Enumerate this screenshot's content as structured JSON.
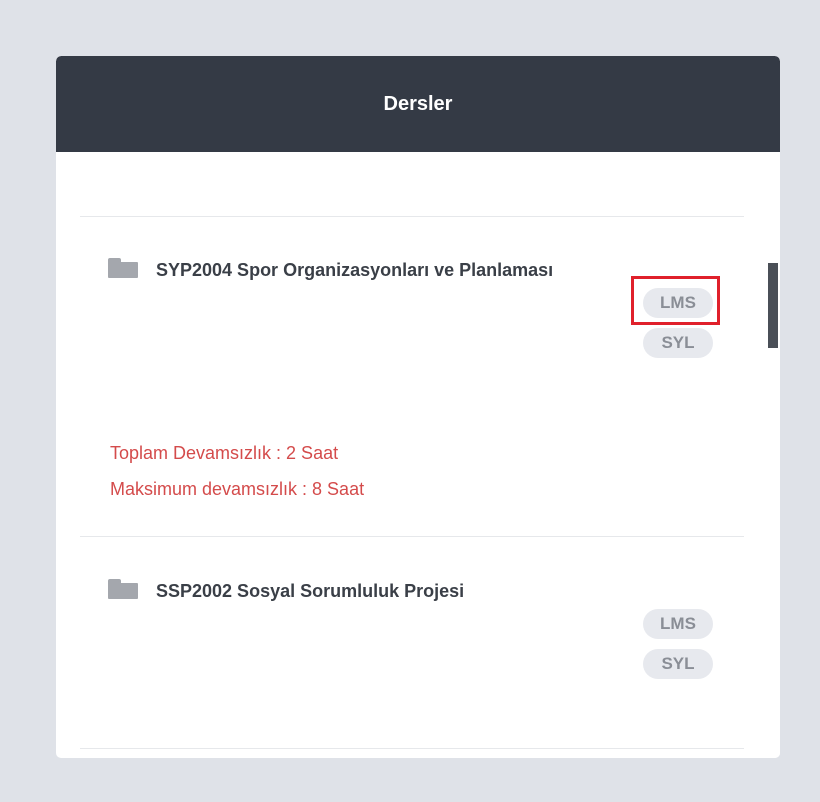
{
  "panel": {
    "title": "Dersler"
  },
  "courses": [
    {
      "title": "SYP2004 Spor Organizasyonları ve Planlaması",
      "badges": [
        "LMS",
        "SYL"
      ],
      "absence": {
        "total": "Toplam Devamsızlık : 2 Saat",
        "max": "Maksimum devamsızlık : 8 Saat"
      }
    },
    {
      "title": "SSP2002 Sosyal Sorumluluk Projesi",
      "badges": [
        "LMS",
        "SYL"
      ]
    }
  ],
  "icons": {
    "course_icon": "folder-icon"
  },
  "colors": {
    "header_bg": "#343a45",
    "absence_text": "#d44b4b",
    "highlight": "#e0202b",
    "badge_bg": "#e7e9ee"
  }
}
